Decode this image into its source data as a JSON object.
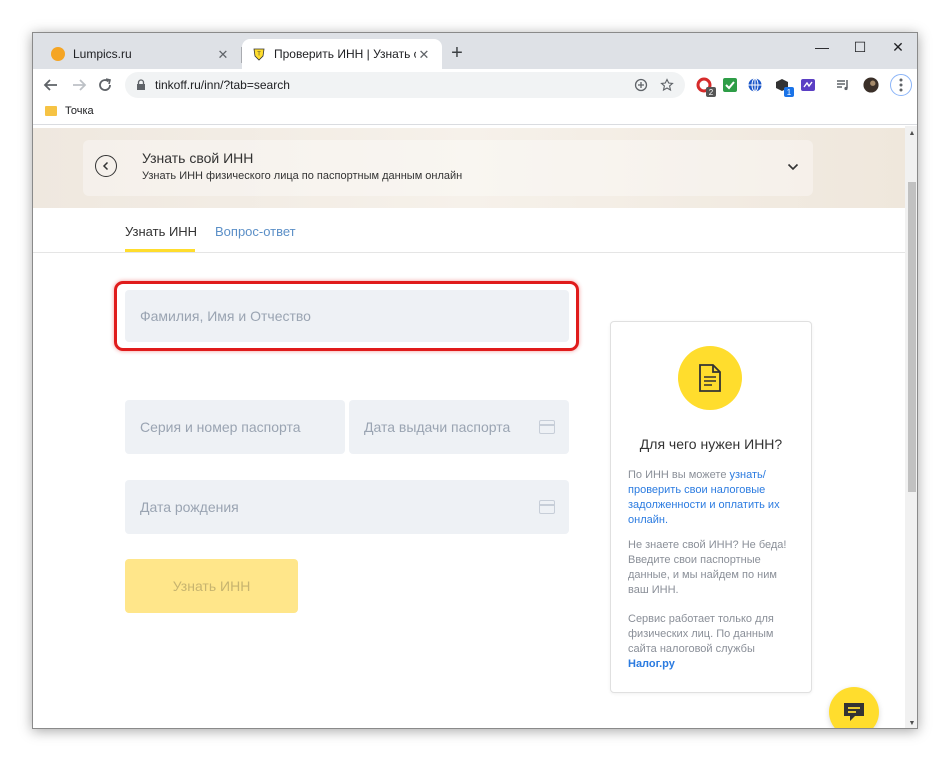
{
  "browser": {
    "tabs": [
      {
        "title": "Lumpics.ru",
        "close": "✕"
      },
      {
        "title": "Проверить ИНН | Узнать свой И",
        "close": "✕"
      }
    ],
    "new_tab": "+",
    "window_controls": {
      "minimize": "—",
      "maximize": "☐",
      "close": "✕"
    },
    "url": "tinkoff.ru/inn/?tab=search",
    "bookmark": "Точка",
    "extension_badges": {
      "first": "2",
      "second": "1"
    }
  },
  "hero": {
    "title": "Узнать свой ИНН",
    "subtitle": "Узнать ИНН физического лица по паспортным данным онлайн",
    "back_symbol": "‹",
    "chevron": "⌄"
  },
  "page_tabs": [
    {
      "label": "Узнать ИНН",
      "active": true
    },
    {
      "label": "Вопрос-ответ",
      "active": false
    }
  ],
  "form": {
    "fio_placeholder": "Фамилия, Имя и Отчество",
    "passport_placeholder": "Серия и номер паспорта",
    "issue_date_placeholder": "Дата выдачи паспорта",
    "birth_date_placeholder": "Дата рождения",
    "submit_label": "Узнать ИНН"
  },
  "info": {
    "title": "Для чего нужен ИНН?",
    "p1_text": "По ИНН вы можете ",
    "p1_link": "узнать/ проверить свои налоговые задолженности и оплатить их онлайн.",
    "p2": "Не знаете свой ИНН? Не беда! Введите свои паспортные данные, и мы найдем по ним ваш ИНН.",
    "p3_text": "Сервис работает только для физических лиц. По данным сайта налоговой службы ",
    "p3_link": "Налог.ру"
  },
  "colors": {
    "accent_yellow": "#ffdd2d",
    "highlight_red": "#e01b1b",
    "link_blue": "#2b7be0"
  }
}
